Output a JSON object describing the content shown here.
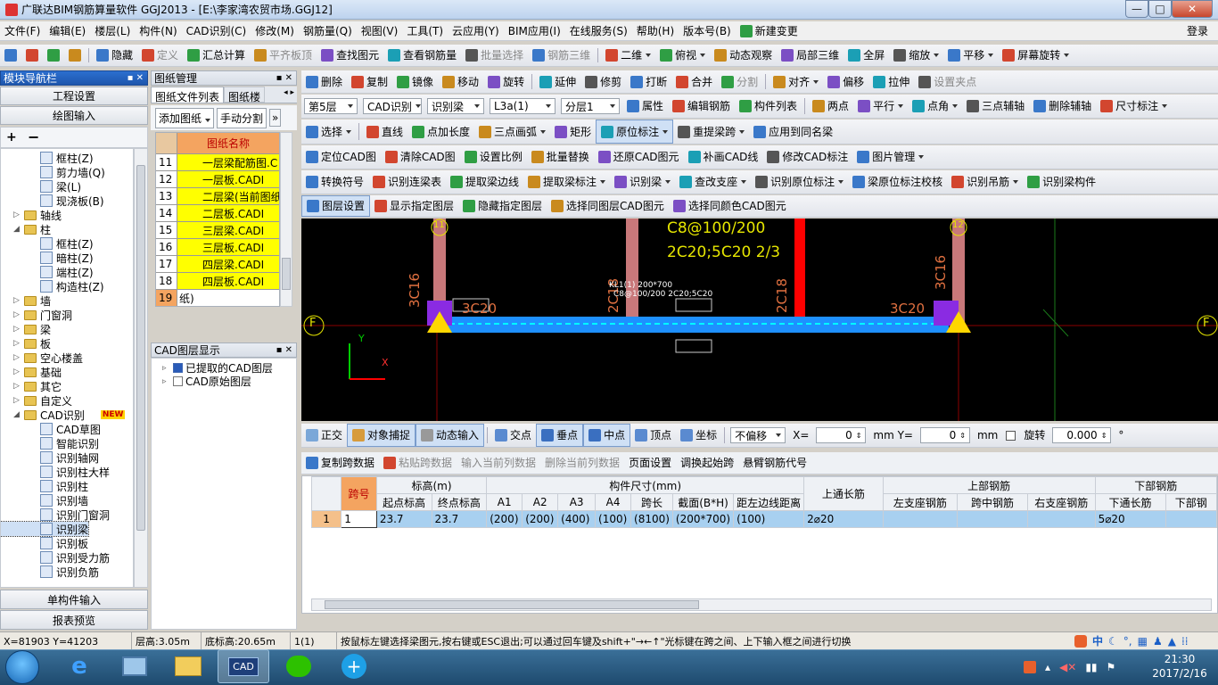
{
  "window": {
    "title": "广联达BIM钢筋算量软件 GGJ2013 - [E:\\李家湾农贸市场.GGJ12]",
    "minimize": "—",
    "maximize": "□",
    "close": "✕"
  },
  "menu": {
    "items": [
      "文件(F)",
      "编辑(E)",
      "楼层(L)",
      "构件(N)",
      "CAD识别(C)",
      "修改(M)",
      "钢筋量(Q)",
      "视图(V)",
      "工具(T)",
      "云应用(Y)",
      "BIM应用(I)",
      "在线服务(S)",
      "帮助(H)",
      "版本号(B)"
    ],
    "new_change": "新建变更",
    "login": "登录"
  },
  "toolbar1": {
    "items": [
      "隐藏",
      "定义",
      "汇总计算",
      "平齐板顶",
      "查找图元",
      "查看钢筋量",
      "批量选择",
      "钢筋三维",
      "二维",
      "俯视",
      "动态观察",
      "局部三维",
      "全屏",
      "缩放",
      "平移",
      "屏幕旋转"
    ]
  },
  "toolbar2": {
    "items": [
      "删除",
      "复制",
      "镜像",
      "移动",
      "旋转",
      "延伸",
      "修剪",
      "打断",
      "合并",
      "分割",
      "对齐",
      "偏移",
      "拉伸",
      "设置夹点"
    ]
  },
  "toolbar3": {
    "floor": "第5层",
    "cad": "CAD识别",
    "beam": "识别梁",
    "l3a": "L3a(1)",
    "layer": "分层1",
    "items": [
      "属性",
      "编辑钢筋",
      "构件列表",
      "两点",
      "平行",
      "点角",
      "三点辅轴",
      "删除辅轴",
      "尺寸标注"
    ]
  },
  "toolbar4": {
    "items": [
      "选择",
      "直线",
      "点加长度",
      "三点画弧",
      "矩形",
      "原位标注",
      "重提梁跨",
      "应用到同名梁"
    ]
  },
  "toolbar5": {
    "items": [
      "定位CAD图",
      "清除CAD图",
      "设置比例",
      "批量替换",
      "还原CAD图元",
      "补画CAD线",
      "修改CAD标注",
      "图片管理"
    ]
  },
  "toolbar6": {
    "items": [
      "转换符号",
      "识别连梁表",
      "提取梁边线",
      "提取梁标注",
      "识别梁",
      "查改支座",
      "识别原位标注",
      "梁原位标注校核",
      "识别吊筋",
      "识别梁构件"
    ]
  },
  "toolbar7": {
    "items": [
      "图层设置",
      "显示指定图层",
      "隐藏指定图层",
      "选择同图层CAD图元",
      "选择同颜色CAD图元"
    ]
  },
  "nav": {
    "title": "模块导航栏",
    "project": "工程设置",
    "drawing": "绘图输入",
    "single": "单构件输入",
    "report": "报表预览",
    "tree": [
      {
        "level": 2,
        "type": "leaf",
        "label": "框柱(Z)"
      },
      {
        "level": 2,
        "type": "leaf",
        "label": "剪力墙(Q)"
      },
      {
        "level": 2,
        "type": "leaf",
        "label": "梁(L)"
      },
      {
        "level": 2,
        "type": "leaf",
        "label": "现浇板(B)"
      },
      {
        "level": 1,
        "type": "folder",
        "label": "轴线"
      },
      {
        "level": 1,
        "type": "folder",
        "label": "柱",
        "open": true
      },
      {
        "level": 2,
        "type": "leaf",
        "label": "框柱(Z)"
      },
      {
        "level": 2,
        "type": "leaf",
        "label": "暗柱(Z)"
      },
      {
        "level": 2,
        "type": "leaf",
        "label": "端柱(Z)"
      },
      {
        "level": 2,
        "type": "leaf",
        "label": "构造柱(Z)"
      },
      {
        "level": 1,
        "type": "folder",
        "label": "墙"
      },
      {
        "level": 1,
        "type": "folder",
        "label": "门窗洞"
      },
      {
        "level": 1,
        "type": "folder",
        "label": "梁"
      },
      {
        "level": 1,
        "type": "folder",
        "label": "板"
      },
      {
        "level": 1,
        "type": "folder",
        "label": "空心楼盖"
      },
      {
        "level": 1,
        "type": "folder",
        "label": "基础"
      },
      {
        "level": 1,
        "type": "folder",
        "label": "其它"
      },
      {
        "level": 1,
        "type": "folder",
        "label": "自定义"
      },
      {
        "level": 1,
        "type": "folder",
        "label": "CAD识别",
        "open": true,
        "badge": "NEW"
      },
      {
        "level": 2,
        "type": "leaf",
        "label": "CAD草图"
      },
      {
        "level": 2,
        "type": "leaf",
        "label": "智能识别"
      },
      {
        "level": 2,
        "type": "leaf",
        "label": "识别轴网"
      },
      {
        "level": 2,
        "type": "leaf",
        "label": "识别柱大样"
      },
      {
        "level": 2,
        "type": "leaf",
        "label": "识别柱"
      },
      {
        "level": 2,
        "type": "leaf",
        "label": "识别墙"
      },
      {
        "level": 2,
        "type": "leaf",
        "label": "识别门窗洞"
      },
      {
        "level": 2,
        "type": "leaf",
        "label": "识别梁",
        "selected": true
      },
      {
        "level": 2,
        "type": "leaf",
        "label": "识别板"
      },
      {
        "level": 2,
        "type": "leaf",
        "label": "识别受力筋"
      },
      {
        "level": 2,
        "type": "leaf",
        "label": "识别负筋"
      }
    ]
  },
  "drawings": {
    "title": "图纸管理",
    "tab1": "图纸文件列表",
    "tab2": "图纸楼",
    "add": "添加图纸",
    "split": "手动分割",
    "col": "图纸名称",
    "rows": [
      {
        "n": "11",
        "name": "一层梁配筋图.C"
      },
      {
        "n": "12",
        "name": "一层板.CADI"
      },
      {
        "n": "13",
        "name": "二层梁(当前图纸"
      },
      {
        "n": "14",
        "name": "二层板.CADI"
      },
      {
        "n": "15",
        "name": "三层梁.CADI"
      },
      {
        "n": "16",
        "name": "三层板.CADI"
      },
      {
        "n": "17",
        "name": "四层梁.CADI"
      },
      {
        "n": "18",
        "name": "四层板.CADI"
      },
      {
        "n": "19",
        "name": "纸)"
      }
    ]
  },
  "cad_layers": {
    "title": "CAD图层显示",
    "items": [
      "已提取的CAD图层",
      "CAD原始图层"
    ]
  },
  "canvas": {
    "t1": "C8@100/200",
    "t2": "2C20;5C20 2/3",
    "t3": "3C16",
    "t4": "3C20",
    "t5": "2C18",
    "t6": "2C18",
    "t7": "3C20",
    "t8": "3C16",
    "t9": "KL1(1) 200*700",
    "t10": "C8@100/200 2C20;5C20",
    "axis_l": "F",
    "axis_r": "F",
    "c11": "11",
    "c12": "12",
    "ax_x": "X",
    "ax_y": "Y"
  },
  "snapbar": {
    "ortho": "正交",
    "snap": "对象捕捉",
    "dyn": "动态输入",
    "cross": "交点",
    "perp": "垂点",
    "mid": "中点",
    "vertex": "顶点",
    "coord": "坐标",
    "offset": "不偏移",
    "x_label": "X=",
    "x_val": "0",
    "y_label": "mm Y=",
    "y_val": "0",
    "mm": "mm",
    "rotate": "旋转",
    "rot_val": "0.000",
    "deg": "°"
  },
  "table_toolbar": {
    "items": [
      "复制跨数据",
      "粘贴跨数据",
      "输入当前列数据",
      "删除当前列数据",
      "页面设置",
      "调换起始跨",
      "悬臂钢筋代号"
    ]
  },
  "beam_table": {
    "h_span": "跨号",
    "h_elev": "标高(m)",
    "h_dim": "构件尺寸(mm)",
    "h_top": "上通长筋",
    "h_upper": "上部钢筋",
    "h_lower": "下部钢筋",
    "h_start": "起点标高",
    "h_end": "终点标高",
    "h_a1": "A1",
    "h_a2": "A2",
    "h_a3": "A3",
    "h_a4": "A4",
    "h_len": "跨长",
    "h_sec": "截面(B*H)",
    "h_edge": "距左边线距离",
    "h_left": "左支座钢筋",
    "h_mid": "跨中钢筋",
    "h_right": "右支座钢筋",
    "h_lowcont": "下通长筋",
    "h_lowrest": "下部钢",
    "row": {
      "idx": "1",
      "span": "1",
      "start": "23.7",
      "end": "23.7",
      "a1": "(200)",
      "a2": "(200)",
      "a3": "(400)",
      "a4": "(100)",
      "len": "(8100)",
      "sec": "(200*700)",
      "edge": "(100)",
      "top": "2⌀20",
      "left": "",
      "mid": "",
      "right": "",
      "lowcont": "5⌀20",
      "lowrest": ""
    }
  },
  "status": {
    "coords": "X=81903 Y=41203",
    "floorh": "层高:3.05m",
    "baseh": "底标高:20.65m",
    "count": "1(1)",
    "hint": "按鼠标左键选择梁图元,按右键或ESC退出;可以通过回车键及shift+\"→←↑\"光标键在跨之间、上下输入框之间进行切换"
  },
  "taskbar": {
    "time": "21:30",
    "date": "2017/2/16",
    "ime": "中",
    "cad": "CAD"
  }
}
